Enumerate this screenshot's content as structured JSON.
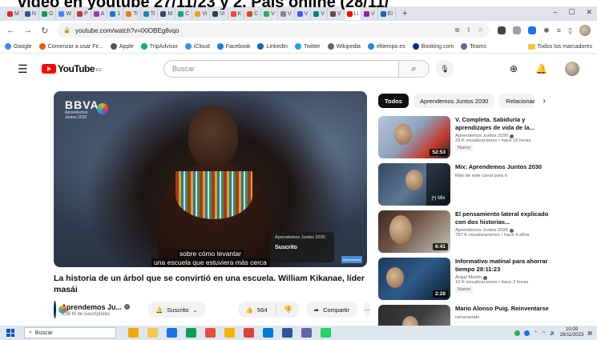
{
  "overlay": {
    "headline": "vídeo en youtube 27/11/23 y 2. País online (28/11/"
  },
  "browser": {
    "tabs": [
      {
        "label": "M",
        "color": "#d93025"
      },
      {
        "label": "N",
        "color": "#2b579a"
      },
      {
        "label": "G",
        "color": "#0f9d58"
      },
      {
        "label": "W",
        "color": "#4285f4"
      },
      {
        "label": "P",
        "color": "#c0392b"
      },
      {
        "label": "A",
        "color": "#8e44ad"
      },
      {
        "label": "1",
        "color": "#1a73e8"
      },
      {
        "label": "Ti",
        "color": "#e67e22"
      },
      {
        "label": "Ti",
        "color": "#2980b9"
      },
      {
        "label": "M",
        "color": "#34495e"
      },
      {
        "label": "C",
        "color": "#16a085"
      },
      {
        "label": "Vi",
        "color": "#f39c12"
      },
      {
        "label": "Vi",
        "color": "#2c3e50"
      },
      {
        "label": "K",
        "color": "#e74c3c"
      },
      {
        "label": "C",
        "color": "#d35400"
      },
      {
        "label": "V",
        "color": "#27ae60"
      },
      {
        "label": "V",
        "color": "#7f8c8d"
      },
      {
        "label": "V",
        "color": "#3d5afe"
      },
      {
        "label": "V",
        "color": "#00897b"
      },
      {
        "label": "V",
        "color": "#6d4c41"
      },
      {
        "label": "Li",
        "color": "#ff0000"
      },
      {
        "label": "V",
        "color": "#8e24aa"
      },
      {
        "label": "Ei",
        "color": "#1565c0"
      }
    ],
    "active_tab_label": "Li",
    "new_tab": "+",
    "url": "youtube.com/watch?v=lXlOBEg8vqo",
    "window_controls": {
      "minimize": "–",
      "restore": "☐",
      "close": "✕"
    },
    "bookmarks": [
      {
        "label": "Google",
        "color": "#4285f4"
      },
      {
        "label": "Comenzar a usar Fir...",
        "color": "#e66000"
      },
      {
        "label": "Apple",
        "color": "#555555"
      },
      {
        "label": "TripAdvisor",
        "color": "#00af87"
      },
      {
        "label": "iCloud",
        "color": "#3693f3"
      },
      {
        "label": "Facebook",
        "color": "#1877f2"
      },
      {
        "label": "LinkedIn",
        "color": "#0a66c2"
      },
      {
        "label": "Twitter",
        "color": "#1da1f2"
      },
      {
        "label": "Wikipedia",
        "color": "#636466"
      },
      {
        "label": "eltiempo.es",
        "color": "#1e88e5"
      },
      {
        "label": "Booking.com",
        "color": "#003580"
      },
      {
        "label": "Teams",
        "color": "#6264a7"
      }
    ],
    "bookmarks_folder": "Todos los marcadores"
  },
  "yt": {
    "logo_text": "YouTube",
    "country_code": "ES",
    "search_placeholder": "Buscar",
    "colors": {
      "brand": "#ff0000",
      "text": "#0f0f0f",
      "secondary": "#606060"
    }
  },
  "player": {
    "brand": "BBVA",
    "brand_sub": "Aprendemos Juntos 2030",
    "caption_line1": "sobre cómo levantar",
    "caption_line2": "una escuela que estuviera más cerca",
    "card_channel": "Aprendemos Juntos 2030",
    "card_button": "Suscrito",
    "watermark": "Aprendemos"
  },
  "video": {
    "title": "La historia de un árbol que se convirtió en una escuela. William Kikanae, líder masái",
    "channel": "Aprendemos Ju...",
    "subscribers": "3,99 M de suscriptores",
    "subscribed_label": "Suscrito",
    "likes": "564",
    "share_label": "Compartir",
    "more": "···"
  },
  "chips": [
    {
      "label": "Todos",
      "active": true
    },
    {
      "label": "Aprendemos Juntos 2030",
      "active": false
    },
    {
      "label": "Relacionad",
      "active": false
    }
  ],
  "recommendations": [
    {
      "title": "V. Completa. Sabiduría y aprendizajes de vida de la...",
      "channel": "Aprendemos Juntos 2030",
      "meta": "29 K visualizaciones • hace 16 horas",
      "badge": "Nuevo",
      "duration": "52:53",
      "verified": true
    },
    {
      "title": "Mix: Aprendemos Juntos 2030",
      "channel": "Más de este canal para ti",
      "meta": "",
      "badge": "",
      "duration": "(•) Mix",
      "verified": false
    },
    {
      "title": "El pensamiento lateral explicado con dos historias...",
      "channel": "Aprendemos Juntos 2030",
      "meta": "767 K visualizaciones • hace 4 años",
      "badge": "",
      "duration": "6:41",
      "verified": true
    },
    {
      "title": "Informativo matinal para ahorrar tiempo 28:11:23",
      "channel": "Ángel Martín",
      "meta": "10 K visualizaciones • hace 2 horas",
      "badge": "Nuevo",
      "duration": "2:28",
      "verified": true
    },
    {
      "title": "Mario Alonso Puig. Reinventarse",
      "channel": "cenavarratv",
      "meta": "",
      "badge": "",
      "duration": "",
      "verified": false
    }
  ],
  "taskbar": {
    "search_label": "Buscar",
    "time": "10:09",
    "date": "28/11/2023",
    "apps": [
      "#f2a900",
      "#f2c94c",
      "#1a73e8",
      "#0f9d58",
      "#e74c3c",
      "#f4b400",
      "#db4437",
      "#0078d4",
      "#2b579a",
      "#6264a7",
      "#25d366"
    ]
  }
}
